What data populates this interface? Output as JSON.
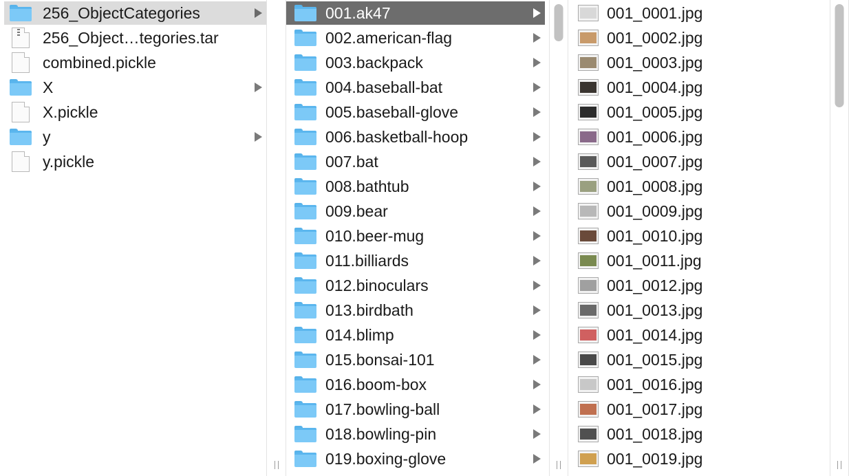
{
  "column1": {
    "items": [
      {
        "label": "256_ObjectCategories",
        "icon": "folder-icon",
        "has_children": true,
        "selected": true
      },
      {
        "label": "256_Object…tegories.tar",
        "icon": "archive-icon",
        "has_children": false
      },
      {
        "label": "combined.pickle",
        "icon": "document-icon",
        "has_children": false
      },
      {
        "label": "X",
        "icon": "folder-icon",
        "has_children": true
      },
      {
        "label": "X.pickle",
        "icon": "document-icon",
        "has_children": false
      },
      {
        "label": "y",
        "icon": "folder-icon",
        "has_children": true
      },
      {
        "label": "y.pickle",
        "icon": "document-icon",
        "has_children": false
      }
    ]
  },
  "column2": {
    "items": [
      {
        "label": "001.ak47",
        "selected": true
      },
      {
        "label": "002.american-flag"
      },
      {
        "label": "003.backpack"
      },
      {
        "label": "004.baseball-bat"
      },
      {
        "label": "005.baseball-glove"
      },
      {
        "label": "006.basketball-hoop"
      },
      {
        "label": "007.bat"
      },
      {
        "label": "008.bathtub"
      },
      {
        "label": "009.bear"
      },
      {
        "label": "010.beer-mug"
      },
      {
        "label": "011.billiards"
      },
      {
        "label": "012.binoculars"
      },
      {
        "label": "013.birdbath"
      },
      {
        "label": "014.blimp"
      },
      {
        "label": "015.bonsai-101"
      },
      {
        "label": "016.boom-box"
      },
      {
        "label": "017.bowling-ball"
      },
      {
        "label": "018.bowling-pin"
      },
      {
        "label": "019.boxing-glove"
      }
    ]
  },
  "column3": {
    "items": [
      {
        "label": "001_0001.jpg",
        "thumb": "#d8d8d8"
      },
      {
        "label": "001_0002.jpg",
        "thumb": "#c89a6a"
      },
      {
        "label": "001_0003.jpg",
        "thumb": "#9a8a70"
      },
      {
        "label": "001_0004.jpg",
        "thumb": "#3a3530"
      },
      {
        "label": "001_0005.jpg",
        "thumb": "#2c2c2c"
      },
      {
        "label": "001_0006.jpg",
        "thumb": "#8a6a8a"
      },
      {
        "label": "001_0007.jpg",
        "thumb": "#5a5a5a"
      },
      {
        "label": "001_0008.jpg",
        "thumb": "#9aa080"
      },
      {
        "label": "001_0009.jpg",
        "thumb": "#b8b8b8"
      },
      {
        "label": "001_0010.jpg",
        "thumb": "#6a4a3a"
      },
      {
        "label": "001_0011.jpg",
        "thumb": "#7a8a50"
      },
      {
        "label": "001_0012.jpg",
        "thumb": "#a0a0a0"
      },
      {
        "label": "001_0013.jpg",
        "thumb": "#6a6a6a"
      },
      {
        "label": "001_0014.jpg",
        "thumb": "#d06060"
      },
      {
        "label": "001_0015.jpg",
        "thumb": "#4a4a4a"
      },
      {
        "label": "001_0016.jpg",
        "thumb": "#c8c8c8"
      },
      {
        "label": "001_0017.jpg",
        "thumb": "#c07050"
      },
      {
        "label": "001_0018.jpg",
        "thumb": "#505050"
      },
      {
        "label": "001_0019.jpg",
        "thumb": "#d0a050"
      }
    ]
  },
  "colors": {
    "selected_active": "#6d6d6d",
    "selected_inactive": "#dcdcdc",
    "folder": "#7cc9f7"
  }
}
